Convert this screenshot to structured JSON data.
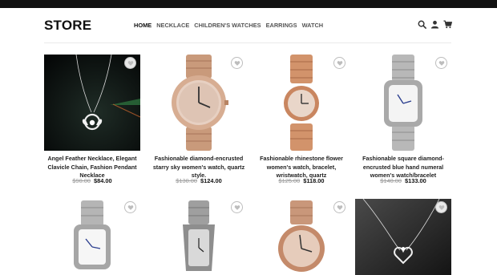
{
  "brand": "STORE",
  "nav": [
    {
      "label": "HOME",
      "active": true
    },
    {
      "label": "NECKLACE",
      "active": false
    },
    {
      "label": "CHILDREN'S WATCHES",
      "active": false
    },
    {
      "label": "EARRINGS",
      "active": false
    },
    {
      "label": "WATCH",
      "active": false
    }
  ],
  "header_icons": [
    "search-icon",
    "account-icon",
    "cart-icon"
  ],
  "products": [
    {
      "title": "Angel Feather Necklace, Elegant Clavicle Chain, Fashion Pendant Necklace",
      "old_price": "$90.00",
      "price": "$84.00",
      "image": "necklace"
    },
    {
      "title": "Fashionable diamond-encrusted starry sky women's watch, quartz style.",
      "old_price": "$130.00",
      "price": "$124.00",
      "image": "rose-gold-watch"
    },
    {
      "title": "Fashionable rhinestone flower women's watch, bracelet, wristwatch, quartz",
      "old_price": "$125.00",
      "price": "$118.00",
      "image": "rose-gold-bracelet-watch"
    },
    {
      "title": "Fashionable square diamond-encrusted blue hand numeral women's watch/bracelet",
      "old_price": "$140.00",
      "price": "$133.00",
      "image": "silver-square-watch"
    },
    {
      "title": "",
      "old_price": "",
      "price": "",
      "image": "silver-square-blue-watch"
    },
    {
      "title": "",
      "old_price": "",
      "price": "",
      "image": "silver-rectangle-watch"
    },
    {
      "title": "",
      "old_price": "",
      "price": "",
      "image": "rose-gold-diamond-watch"
    },
    {
      "title": "",
      "old_price": "",
      "price": "",
      "image": "heart-necklace"
    }
  ],
  "colors": {
    "accent": "#111111",
    "old_price": "#9a9a9a",
    "rose_gold": "#c99a7b",
    "silver": "#b8b8b8"
  }
}
